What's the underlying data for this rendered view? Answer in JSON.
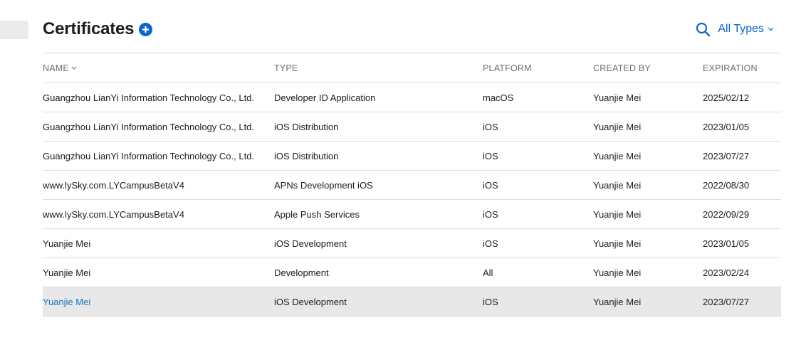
{
  "header": {
    "title": "Certificates",
    "filter_label": "All Types"
  },
  "icons": {
    "add": "plus-circle-icon",
    "search": "search-icon",
    "filter_chevron": "chevron-down-icon",
    "sort_chevron": "chevron-down-icon"
  },
  "colors": {
    "accent": "#0b66d0",
    "link": "#1a73c8",
    "selected_row": "#e8e8e8"
  },
  "table": {
    "columns": {
      "name": "NAME",
      "type": "TYPE",
      "platform": "PLATFORM",
      "created_by": "CREATED BY",
      "expiration": "EXPIRATION"
    },
    "rows": [
      {
        "name": "Guangzhou LianYi Information Technology Co., Ltd.",
        "type": "Developer ID Application",
        "platform": "macOS",
        "created_by": "Yuanjie Mei",
        "expiration": "2025/02/12"
      },
      {
        "name": "Guangzhou LianYi Information Technology Co., Ltd.",
        "type": "iOS Distribution",
        "platform": "iOS",
        "created_by": "Yuanjie Mei",
        "expiration": "2023/01/05"
      },
      {
        "name": "Guangzhou LianYi Information Technology Co., Ltd.",
        "type": "iOS Distribution",
        "platform": "iOS",
        "created_by": "Yuanjie Mei",
        "expiration": "2023/07/27"
      },
      {
        "name": "www.lySky.com.LYCampusBetaV4",
        "type": "APNs Development iOS",
        "platform": "iOS",
        "created_by": "Yuanjie Mei",
        "expiration": "2022/08/30"
      },
      {
        "name": "www.lySky.com.LYCampusBetaV4",
        "type": "Apple Push Services",
        "platform": "iOS",
        "created_by": "Yuanjie Mei",
        "expiration": "2022/09/29"
      },
      {
        "name": "Yuanjie Mei",
        "type": "iOS Development",
        "platform": "iOS",
        "created_by": "Yuanjie Mei",
        "expiration": "2023/01/05"
      },
      {
        "name": "Yuanjie Mei",
        "type": "Development",
        "platform": "All",
        "created_by": "Yuanjie Mei",
        "expiration": "2023/02/24"
      },
      {
        "name": "Yuanjie Mei",
        "type": "iOS Development",
        "platform": "iOS",
        "created_by": "Yuanjie Mei",
        "expiration": "2023/07/27",
        "selected": true
      }
    ]
  }
}
